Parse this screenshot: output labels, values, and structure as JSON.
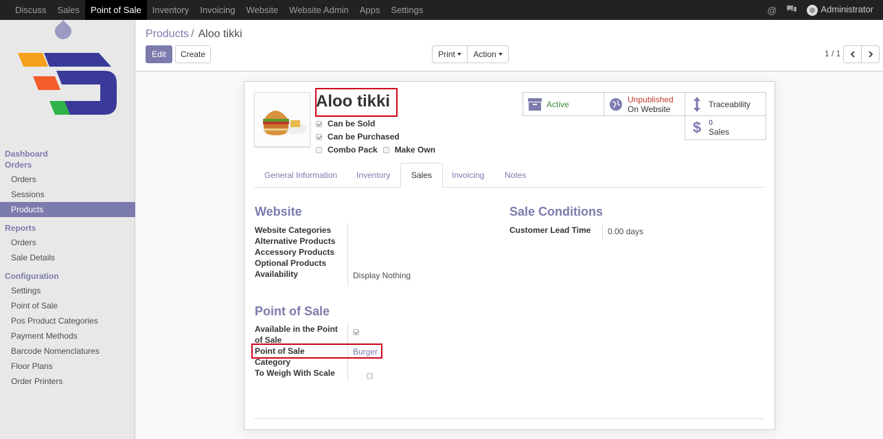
{
  "topbar": {
    "menu": [
      "Discuss",
      "Sales",
      "Point of Sale",
      "Inventory",
      "Invoicing",
      "Website",
      "Website Admin",
      "Apps",
      "Settings"
    ],
    "active": "Point of Sale",
    "user": "Administrator",
    "colors": {
      "bar": "#222222",
      "accent": "#7c7bad"
    }
  },
  "sidebar": {
    "dashboard": "Dashboard",
    "orders_section": "Orders",
    "orders_items": [
      "Orders",
      "Sessions",
      "Products"
    ],
    "active_item": "Products",
    "reports_section": "Reports",
    "reports_items": [
      "Orders",
      "Sale Details"
    ],
    "config_section": "Configuration",
    "config_items": [
      "Settings",
      "Point of Sale",
      "Pos Product Categories",
      "Payment Methods",
      "Barcode Nomenclatures",
      "Floor Plans",
      "Order Printers"
    ]
  },
  "control_panel": {
    "breadcrumb_parent": "Products",
    "breadcrumb_sep": "/",
    "breadcrumb_current": "Aloo tikki",
    "edit_label": "Edit",
    "create_label": "Create",
    "print_label": "Print",
    "action_label": "Action",
    "pager": "1 / 1"
  },
  "product": {
    "name": "Aloo tikki",
    "can_be_sold": "Can be Sold",
    "can_be_purchased": "Can be Purchased",
    "combo_pack": "Combo Pack",
    "make_own": "Make Own",
    "smart_buttons": {
      "active": "Active",
      "unpublished": "Unpublished",
      "on_website": "On Website",
      "traceability": "Traceability",
      "sales_count": "0",
      "sales_label": "Sales"
    }
  },
  "tabs": [
    "General Information",
    "Inventory",
    "Sales",
    "Invoicing",
    "Notes"
  ],
  "active_tab": "Sales",
  "sales_tab": {
    "website_title": "Website",
    "website_fields": {
      "categories": "Website Categories",
      "alternative": "Alternative Products",
      "accessory": "Accessory Products",
      "optional": "Optional Products",
      "availability": "Availability",
      "availability_value": "Display Nothing"
    },
    "sale_conditions_title": "Sale Conditions",
    "lead_time_label": "Customer Lead Time",
    "lead_time_value": "0.00 days",
    "pos_title": "Point of Sale",
    "available_pos_line1": "Available in the Point",
    "available_pos_line2": "of Sale",
    "pos_category_line1": "Point of Sale",
    "pos_category_line2": "Category",
    "pos_category_value": "Burger",
    "weigh_scale": "To Weigh With Scale"
  }
}
